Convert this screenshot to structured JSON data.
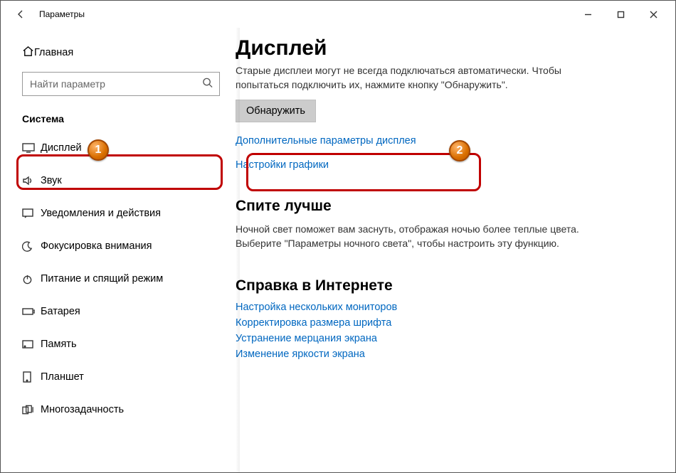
{
  "window": {
    "title": "Параметры"
  },
  "sidebar": {
    "home": "Главная",
    "search_placeholder": "Найти параметр",
    "group": "Система",
    "items": [
      {
        "label": "Дисплей"
      },
      {
        "label": "Звук"
      },
      {
        "label": "Уведомления и действия"
      },
      {
        "label": "Фокусировка внимания"
      },
      {
        "label": "Питание и спящий режим"
      },
      {
        "label": "Батарея"
      },
      {
        "label": "Память"
      },
      {
        "label": "Планшет"
      },
      {
        "label": "Многозадачность"
      }
    ]
  },
  "main": {
    "heading": "Дисплей",
    "old_displays_text": "Старые дисплеи могут не всегда подключаться автоматически. Чтобы попытаться подключить их, нажмите кнопку \"Обнаружить\".",
    "detect_button": "Обнаружить",
    "advanced_link": "Дополнительные параметры дисплея",
    "graphics_link": "Настройки графики",
    "sleep_heading": "Спите лучше",
    "sleep_text": "Ночной свет поможет вам заснуть, отображая ночью более теплые цвета. Выберите \"Параметры ночного света\", чтобы настроить эту функцию.",
    "help_heading": "Справка в Интернете",
    "help_links": [
      "Настройка нескольких мониторов",
      "Корректировка размера шрифта",
      "Устранение мерцания экрана",
      "Изменение яркости экрана"
    ]
  },
  "annotations": {
    "badge1": "1",
    "badge2": "2"
  }
}
